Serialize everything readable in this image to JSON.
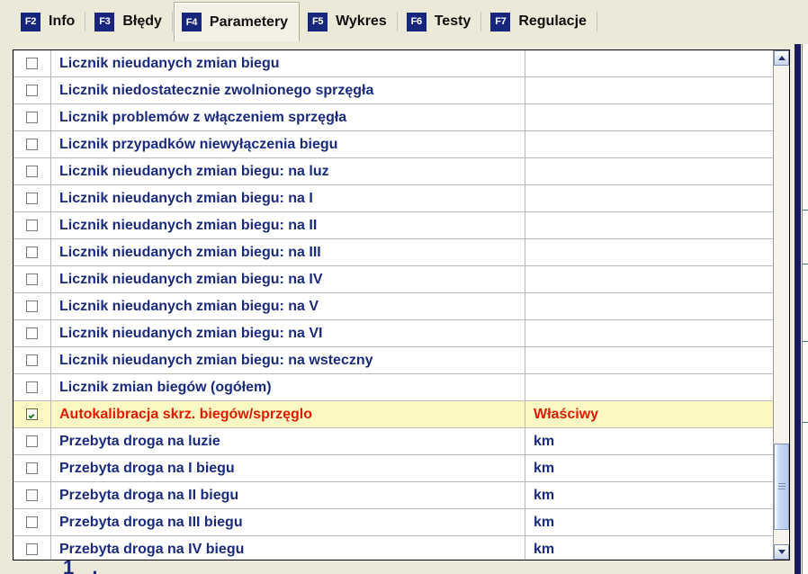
{
  "window": {
    "background_color": "#ece9d8",
    "panel_background": "#ffffff"
  },
  "colors": {
    "fkey_badge": "#17267d",
    "row_text": "#1a2a7c",
    "highlight_row_background": "#fbf8c4",
    "highlight_row_text": "#e01b00",
    "checkbox_check": "#1d7a1d",
    "edge_band": "#191a5e"
  },
  "tabs": [
    {
      "key": "F2",
      "label": "Info",
      "active": false,
      "name": "tab-info"
    },
    {
      "key": "F3",
      "label": "Błędy",
      "active": false,
      "name": "tab-bledy"
    },
    {
      "key": "F4",
      "label": "Parametery",
      "active": true,
      "name": "tab-parametery"
    },
    {
      "key": "F5",
      "label": "Wykres",
      "active": false,
      "name": "tab-wykres"
    },
    {
      "key": "F6",
      "label": "Testy",
      "active": false,
      "name": "tab-testy"
    },
    {
      "key": "F7",
      "label": "Regulacje",
      "active": false,
      "name": "tab-regulacje"
    }
  ],
  "table": {
    "rows": [
      {
        "checked": false,
        "name": "Licznik nieudanych zmian biegu",
        "value": "",
        "highlight": false
      },
      {
        "checked": false,
        "name": "Licznik niedostatecznie zwolnionego sprzęgła",
        "value": "",
        "highlight": false
      },
      {
        "checked": false,
        "name": "Licznik problemów z włączeniem sprzęgła",
        "value": "",
        "highlight": false
      },
      {
        "checked": false,
        "name": "Licznik przypadków niewyłączenia biegu",
        "value": "",
        "highlight": false
      },
      {
        "checked": false,
        "name": "Licznik nieudanych zmian biegu: na luz",
        "value": "",
        "highlight": false
      },
      {
        "checked": false,
        "name": "Licznik nieudanych zmian biegu: na I",
        "value": "",
        "highlight": false
      },
      {
        "checked": false,
        "name": "Licznik nieudanych zmian biegu: na II",
        "value": "",
        "highlight": false
      },
      {
        "checked": false,
        "name": "Licznik nieudanych zmian biegu: na III",
        "value": "",
        "highlight": false
      },
      {
        "checked": false,
        "name": "Licznik nieudanych zmian biegu: na IV",
        "value": "",
        "highlight": false
      },
      {
        "checked": false,
        "name": "Licznik nieudanych zmian biegu: na V",
        "value": "",
        "highlight": false
      },
      {
        "checked": false,
        "name": "Licznik nieudanych zmian biegu: na VI",
        "value": "",
        "highlight": false
      },
      {
        "checked": false,
        "name": "Licznik nieudanych zmian biegu: na wsteczny",
        "value": "",
        "highlight": false
      },
      {
        "checked": false,
        "name": "Licznik zmian biegów (ogółem)",
        "value": "",
        "highlight": false
      },
      {
        "checked": true,
        "name": "Autokalibracja skrz. biegów/sprzęglo",
        "value": "Właściwy",
        "highlight": true
      },
      {
        "checked": false,
        "name": "Przebyta droga na luzie",
        "value": "km",
        "highlight": false
      },
      {
        "checked": false,
        "name": "Przebyta droga na I biegu",
        "value": "km",
        "highlight": false
      },
      {
        "checked": false,
        "name": "Przebyta droga na II biegu",
        "value": "km",
        "highlight": false
      },
      {
        "checked": false,
        "name": "Przebyta droga na III biegu",
        "value": "km",
        "highlight": false
      },
      {
        "checked": false,
        "name": "Przebyta droga na IV biegu",
        "value": "km",
        "highlight": false
      }
    ]
  },
  "scrollbar": {
    "up_arrow": "scroll-up-arrow",
    "down_arrow": "scroll-down-arrow",
    "thumb": "scroll-thumb"
  },
  "bottom_widget": {
    "glyph": "1 ."
  }
}
